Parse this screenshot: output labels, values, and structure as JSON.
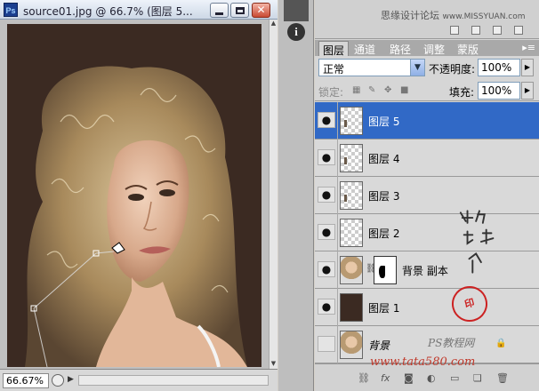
{
  "document": {
    "title": "source01.jpg @ 66.7% (图层 5...",
    "zoom": "66.67%",
    "app_icon": "Ps",
    "close_glyph": "✕"
  },
  "watermarks": {
    "top_cn": "思缘设计论坛",
    "top_url": "www.MISSYUAN.com",
    "ps_site": "PS教程网",
    "url": "www.tata580.com"
  },
  "panel": {
    "tabs": [
      {
        "label": "图层"
      },
      {
        "label": "通道"
      },
      {
        "label": "路径"
      },
      {
        "label": "调整"
      },
      {
        "label": "蒙版"
      }
    ],
    "blend_mode": "正常",
    "opacity_label": "不透明度:",
    "opacity": "100%",
    "lock_label": "锁定:",
    "fill_label": "填充:",
    "fill": "100%",
    "layers": [
      {
        "name": "图层 5",
        "selected": true,
        "visible": true
      },
      {
        "name": "图层 4",
        "selected": false,
        "visible": true
      },
      {
        "name": "图层 3",
        "selected": false,
        "visible": true
      },
      {
        "name": "图层 2",
        "selected": false,
        "visible": true
      },
      {
        "name": "背景 副本",
        "selected": false,
        "visible": true
      },
      {
        "name": "图层 1",
        "selected": false,
        "visible": true
      },
      {
        "name": "背景",
        "selected": false,
        "visible": false
      }
    ],
    "bottom_fx": "fx"
  },
  "colors": {
    "selection": "#3169c6",
    "canvas_bg": "#3b2a22",
    "seal": "#c22222"
  },
  "icons": [
    "ps-logo-icon",
    "minimize-icon",
    "maximize-icon",
    "close-icon",
    "info-icon",
    "eye-icon",
    "link-icon",
    "lock-icon",
    "fx-icon",
    "trash-icon"
  ]
}
